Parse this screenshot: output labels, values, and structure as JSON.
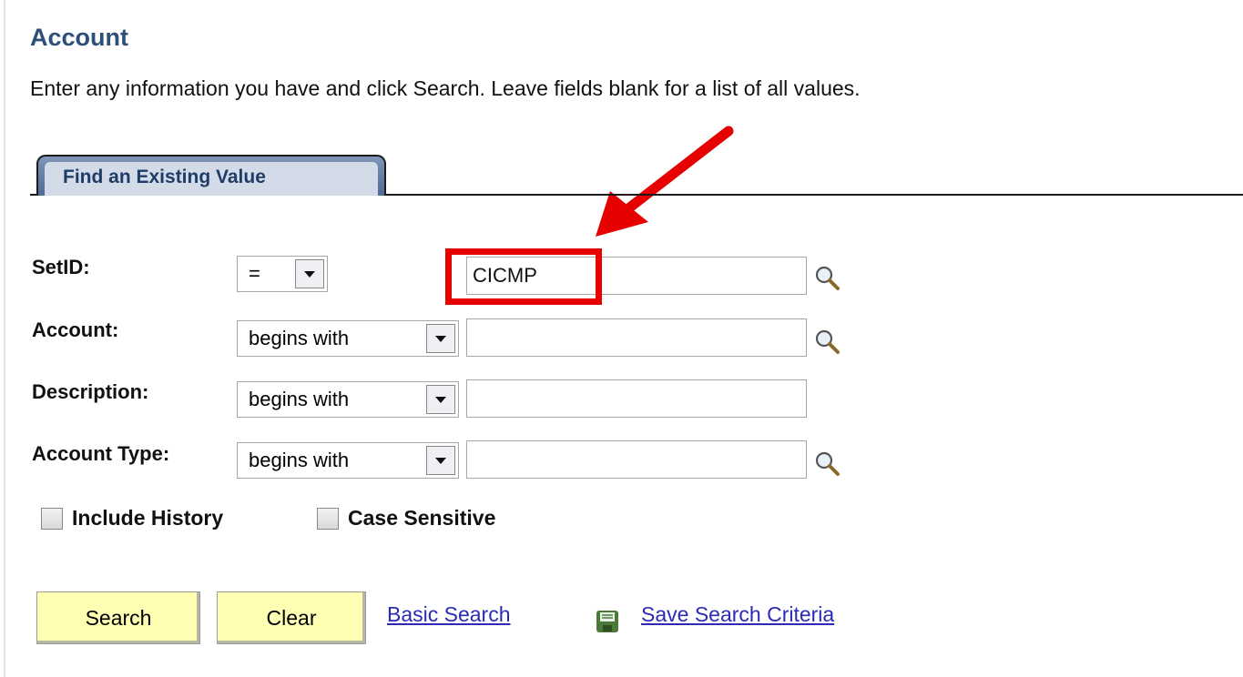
{
  "page": {
    "title": "Account",
    "instructions": "Enter any information you have and click Search. Leave fields blank for a list of all values."
  },
  "tab": {
    "label": "Find an Existing Value"
  },
  "fields": [
    {
      "label": "SetID:",
      "operator": "=",
      "value": "CICMP",
      "has_lookup": true
    },
    {
      "label": "Account:",
      "operator": "begins with",
      "value": "",
      "has_lookup": true
    },
    {
      "label": "Description:",
      "operator": "begins with",
      "value": "",
      "has_lookup": false
    },
    {
      "label": "Account Type:",
      "operator": "begins with",
      "value": "",
      "has_lookup": true
    }
  ],
  "options": [
    {
      "label": "Include History",
      "checked": false
    },
    {
      "label": "Case Sensitive",
      "checked": false
    }
  ],
  "actions": {
    "search": "Search",
    "clear": "Clear",
    "basic_search": "Basic Search",
    "save_criteria": "Save Search Criteria"
  },
  "icons": {
    "lookup": "magnifier-icon",
    "save": "save-disk-icon",
    "dropdown": "chevron-down-icon"
  },
  "colors": {
    "title": "#2e4f7a",
    "tab_bg": "#d3dbe9",
    "button_bg": "#ffffb4",
    "link": "#2b2bb5",
    "annotation": "#e60000"
  }
}
